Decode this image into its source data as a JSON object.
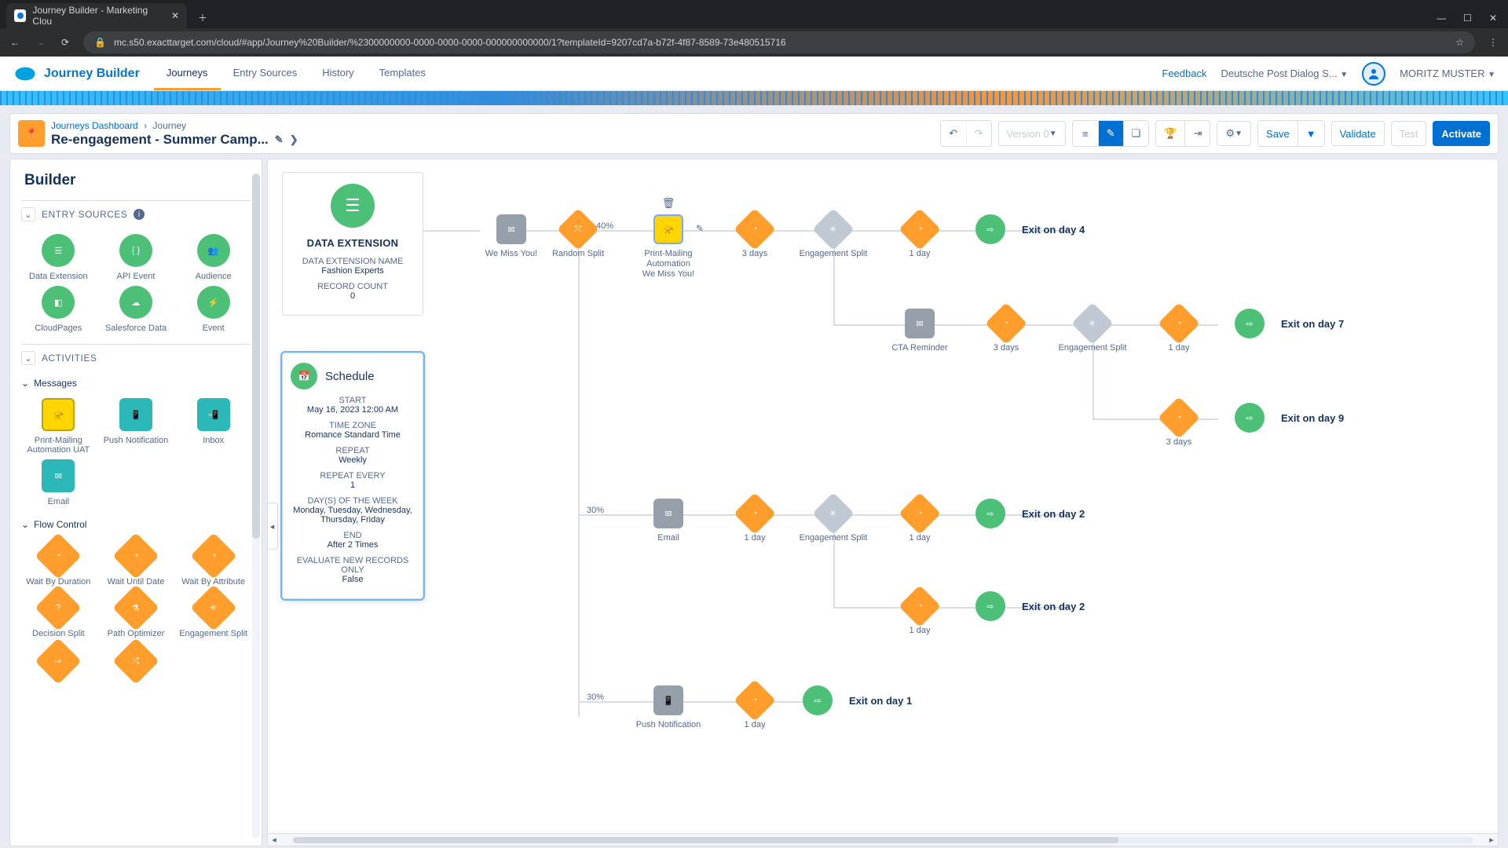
{
  "browser": {
    "tab_title": "Journey Builder - Marketing Clou",
    "url": "mc.s50.exacttarget.com/cloud/#app/Journey%20Builder/%2300000000-0000-0000-0000-000000000000/1?templateId=9207cd7a-b72f-4f87-8589-73e480515716"
  },
  "header": {
    "app_name": "Journey Builder",
    "tabs": [
      "Journeys",
      "Entry Sources",
      "History",
      "Templates"
    ],
    "feedback": "Feedback",
    "org": "Deutsche Post Dialog S...",
    "user": "MORITZ MUSTER"
  },
  "toolbar": {
    "breadcrumb_dashboard": "Journeys Dashboard",
    "breadcrumb_current": "Journey",
    "title": "Re-engagement - Summer Camp...",
    "version": "Version 0",
    "save": "Save",
    "validate": "Validate",
    "test": "Test",
    "activate": "Activate"
  },
  "sidebar": {
    "title": "Builder",
    "section_entry": "ENTRY SOURCES",
    "section_activities": "ACTIVITIES",
    "sub_messages": "Messages",
    "sub_flow": "Flow Control",
    "entry_items": [
      "Data Extension",
      "API Event",
      "Audience",
      "CloudPages",
      "Salesforce Data",
      "Event"
    ],
    "message_items": [
      "Print-Mailing Automation UAT",
      "Push Notification",
      "Inbox",
      "Email"
    ],
    "flow_items": [
      "Wait By Duration",
      "Wait Until Date",
      "Wait By Attribute",
      "Decision Split",
      "Path Optimizer",
      "Engagement Split"
    ]
  },
  "entry_card": {
    "title": "DATA EXTENSION",
    "name_label": "DATA EXTENSION NAME",
    "name_value": "Fashion Experts",
    "count_label": "RECORD COUNT",
    "count_value": "0"
  },
  "schedule": {
    "title": "Schedule",
    "start_k": "START",
    "start_v": "May 16, 2023 12:00 AM",
    "tz_k": "TIME ZONE",
    "tz_v": "Romance Standard Time",
    "repeat_k": "REPEAT",
    "repeat_v": "Weekly",
    "every_k": "REPEAT EVERY",
    "every_v": "1",
    "dow_k": "DAY(S) OF THE WEEK",
    "dow_v": "Monday, Tuesday, Wednesday, Thursday, Friday",
    "end_k": "END",
    "end_v": "After 2 Times",
    "eval_k": "EVALUATE NEW RECORDS ONLY",
    "eval_v": "False"
  },
  "canvas": {
    "pct40": "40%",
    "pct30a": "30%",
    "pct30b": "30%",
    "n": {
      "miss": "We Miss You!",
      "split": "Random Split",
      "print": "Print-Mailing Automation\nWe Miss You!",
      "d3": "3 days",
      "es": "Engagement Split",
      "d1": "1 day",
      "exit4": "Exit on day 4",
      "cta": "CTA Reminder",
      "exit7": "Exit on day 7",
      "exit9": "Exit on day 9",
      "email": "Email",
      "exit2": "Exit on day 2",
      "push": "Push Notification",
      "exit1": "Exit on day 1"
    }
  }
}
